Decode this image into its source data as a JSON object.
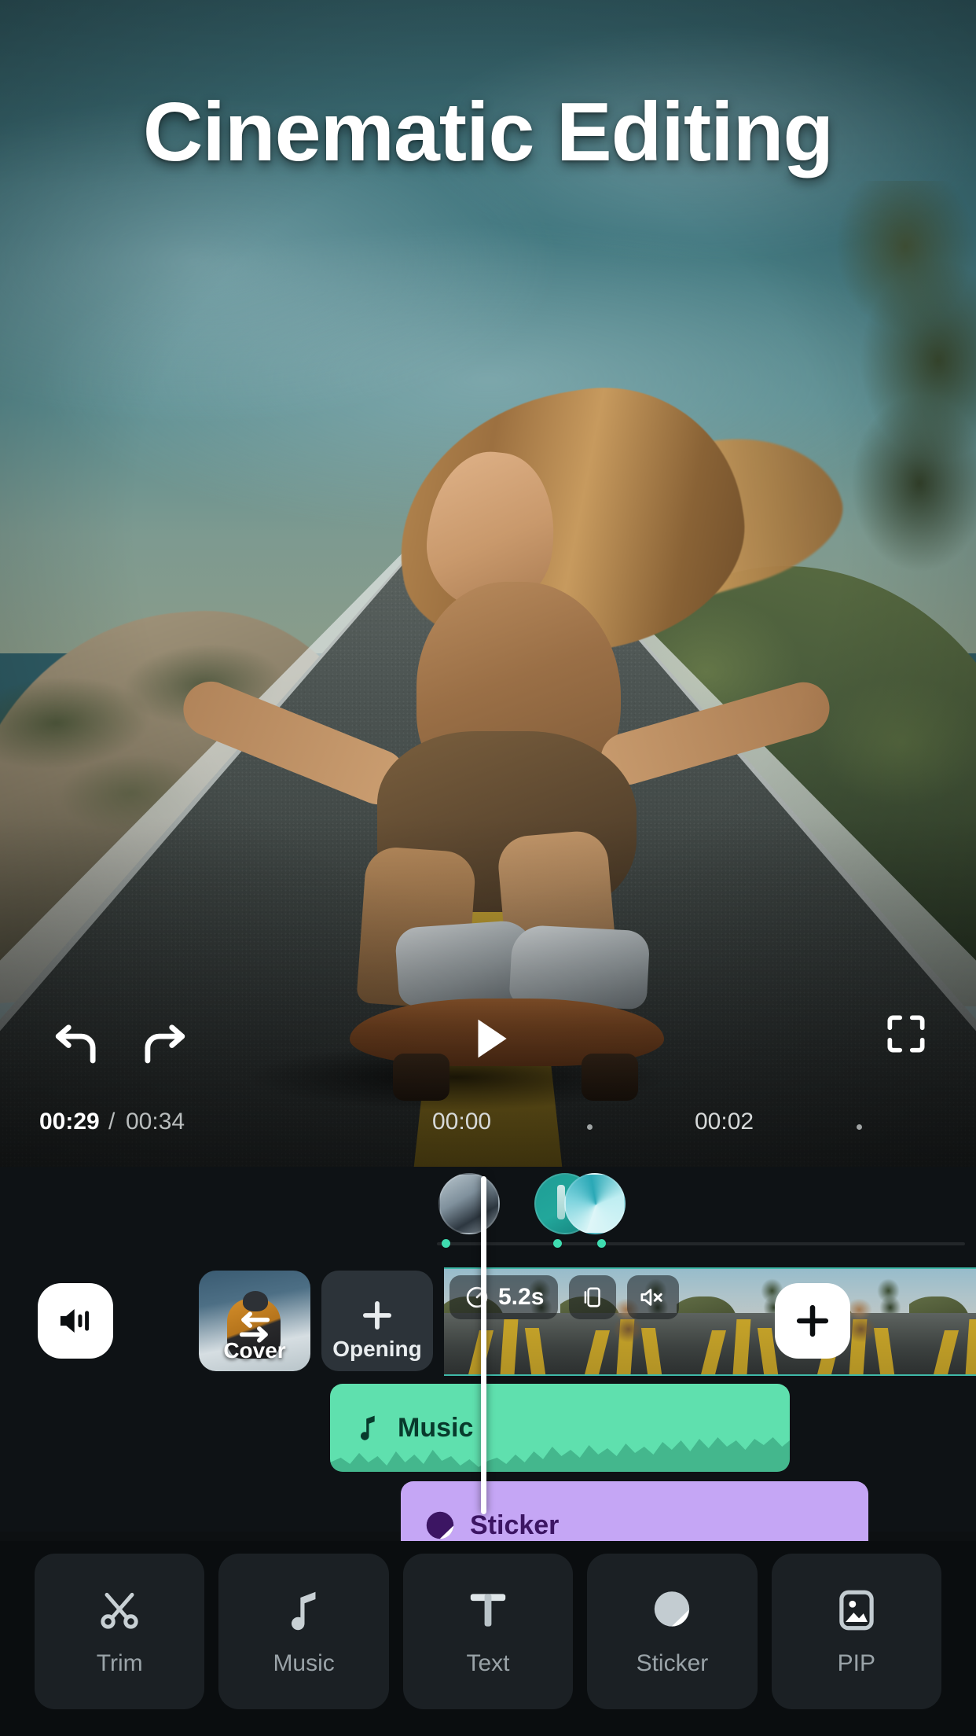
{
  "app": {
    "title_overlay": "Cinematic Editing"
  },
  "player": {
    "current_time": "00:29",
    "separator": "/",
    "total_time": "00:34",
    "controls": [
      {
        "name": "undo",
        "label": "Undo"
      },
      {
        "name": "redo",
        "label": "Redo"
      },
      {
        "name": "play",
        "label": "Play"
      },
      {
        "name": "fullscreen",
        "label": "Fullscreen"
      }
    ]
  },
  "ruler": {
    "marks": [
      "00:00",
      "00:02"
    ],
    "mark_0": "00:00",
    "mark_1": "00:02"
  },
  "timeline": {
    "volume_button_label": "Volume",
    "cover_label": "Cover",
    "opening_label": "Opening",
    "add_clip_label": "+",
    "opening_plus": "+",
    "clip_badges": {
      "speed": "5.2s",
      "crop": "Crop",
      "mute": "Mute"
    },
    "tracks": [
      {
        "name": "music",
        "label": "Music",
        "color": "#5fe0ae"
      },
      {
        "name": "sticker",
        "label": "Sticker",
        "color": "#c5a6f5"
      }
    ],
    "music_label": "Music",
    "sticker_label": "Sticker"
  },
  "toolbar": {
    "items": [
      {
        "name": "trim",
        "label": "Trim",
        "icon": "scissors-icon"
      },
      {
        "name": "music",
        "label": "Music",
        "icon": "music-note-icon"
      },
      {
        "name": "text",
        "label": "Text",
        "icon": "text-t-icon"
      },
      {
        "name": "sticker",
        "label": "Sticker",
        "icon": "sticker-icon"
      },
      {
        "name": "pip",
        "label": "PIP",
        "icon": "picture-in-picture-icon"
      }
    ]
  },
  "colors": {
    "accent_teal": "#3fdcb0",
    "music_track": "#5fe0ae",
    "sticker_track": "#c5a6f5",
    "panel_bg": "#0e1215",
    "toolbar_bg": "#0a0d0f"
  }
}
